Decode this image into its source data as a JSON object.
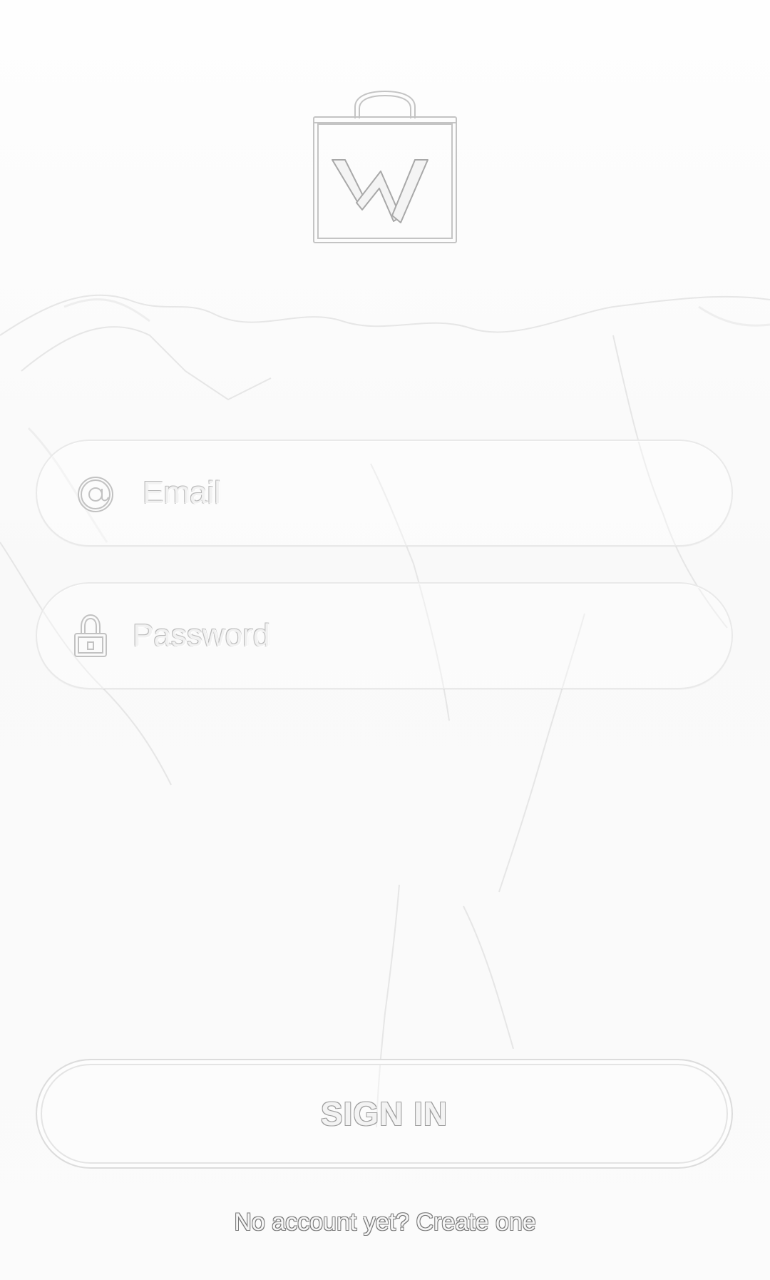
{
  "brand": {
    "logo_icon": "shopping-bag-w-logo-icon"
  },
  "login_form": {
    "email": {
      "icon": "at-sign-icon",
      "placeholder": "Email",
      "value": ""
    },
    "password": {
      "icon": "lock-icon",
      "placeholder": "Password",
      "value": ""
    },
    "sign_in_label": "SIGN IN",
    "create_account_text": "No account yet? Create one"
  },
  "colors": {
    "background": "#fbfbfb",
    "outline": "#dcdcdc",
    "text_outline": "#9e9e9e"
  }
}
